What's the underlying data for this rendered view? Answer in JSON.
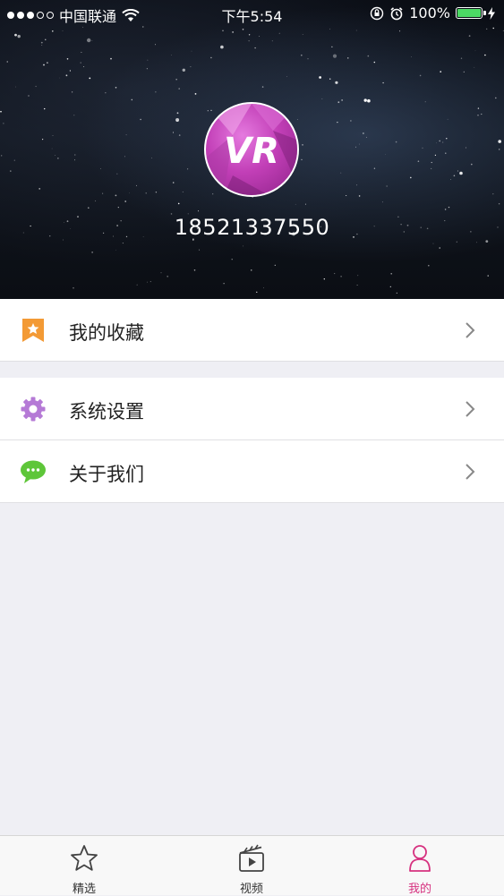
{
  "status_bar": {
    "carrier": "中国联通",
    "time": "下午5:54",
    "battery": "100%"
  },
  "profile": {
    "phone": "18521337550",
    "avatar_text": "VR"
  },
  "menu": {
    "favorites": "我的收藏",
    "settings": "系统设置",
    "about": "关于我们"
  },
  "tabs": [
    {
      "label": "精选",
      "icon": "star-icon"
    },
    {
      "label": "视频",
      "icon": "video-clapper-icon"
    },
    {
      "label": "我的",
      "icon": "person-icon",
      "active": true
    }
  ],
  "colors": {
    "accent": "#d6317f",
    "favorites_icon": "#f39a35",
    "settings_icon": "#b57ad6",
    "about_icon": "#5ec639",
    "battery": "#4cd964"
  }
}
